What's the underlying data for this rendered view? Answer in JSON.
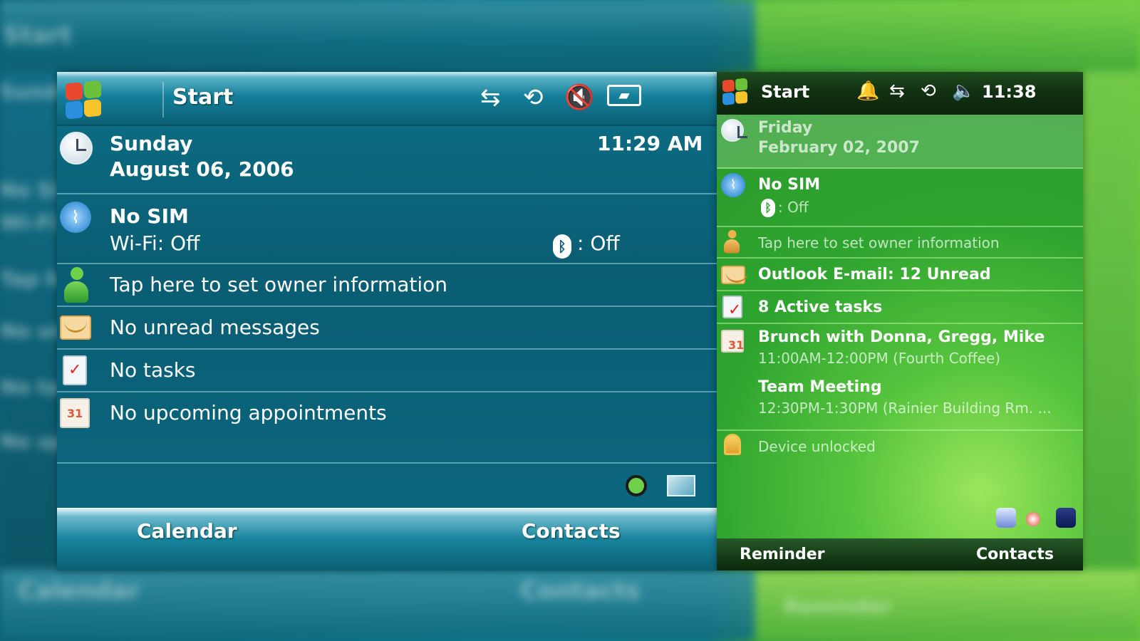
{
  "background": {
    "top_left_label": "Start",
    "bottom_labels": [
      "Calendar",
      "Contacts",
      "Reminder"
    ],
    "left_fragments": [
      "Sunda",
      "No SI",
      "Wi-Fi",
      "Tap h",
      "No un",
      "No ta",
      "No up"
    ]
  },
  "blue_device": {
    "titlebar": {
      "start_label": "Start",
      "icons": [
        "connectivity-icon",
        "sync-icon",
        "volume-muted-icon",
        "battery-icon"
      ]
    },
    "today": {
      "day": "Sunday",
      "date": "August 06, 2006",
      "time": "11:29 AM"
    },
    "wireless": {
      "sim": "No SIM",
      "wifi": "Wi-Fi: Off",
      "bluetooth": ": Off"
    },
    "owner": "Tap here to set owner information",
    "messages": "No unread messages",
    "tasks": "No tasks",
    "appointments": "No upcoming appointments",
    "softkeys": {
      "left": "Calendar",
      "right": "Contacts"
    },
    "colors": {
      "accent": "#0b6880",
      "text": "#ffffff"
    }
  },
  "green_device": {
    "titlebar": {
      "start_label": "Start",
      "time": "11:38",
      "icons": [
        "notification-bell-icon",
        "connectivity-icon",
        "sync-icon",
        "volume-icon"
      ]
    },
    "today": {
      "day": "Friday",
      "date": "February 02, 2007"
    },
    "wireless": {
      "sim": "No SIM",
      "bluetooth": ": Off"
    },
    "owner": "Tap here to set owner information",
    "email": "Outlook E-mail: 12 Unread",
    "tasks": "8 Active tasks",
    "appointments": [
      {
        "title": "Brunch with Donna, Gregg, Mike",
        "detail": "11:00AM-12:00PM (Fourth Coffee)"
      },
      {
        "title": "Team Meeting",
        "detail": "12:30PM-1:30PM (Rainier Building Rm. ..."
      }
    ],
    "lock": "Device unlocked",
    "softkeys": {
      "left": "Reminder",
      "right": "Contacts"
    },
    "colors": {
      "accent": "#2ea42f",
      "titlebar": "#112f12"
    }
  }
}
